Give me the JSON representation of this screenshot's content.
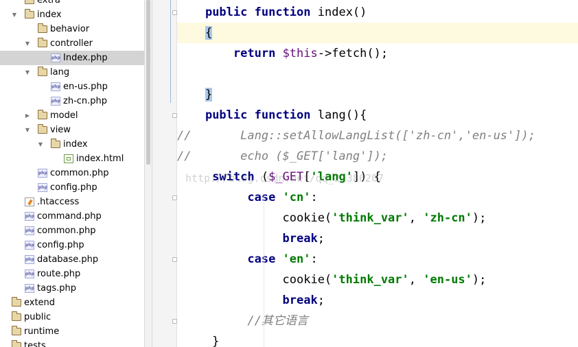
{
  "project_tree": {
    "rows": [
      {
        "label": "extra",
        "type": "folder",
        "depth": 1,
        "arrow": "",
        "selected": false
      },
      {
        "label": "index",
        "type": "folder",
        "depth": 1,
        "arrow": "down",
        "selected": false
      },
      {
        "label": "behavior",
        "type": "folder",
        "depth": 2,
        "arrow": "",
        "selected": false
      },
      {
        "label": "controller",
        "type": "folder",
        "depth": 2,
        "arrow": "down",
        "selected": false
      },
      {
        "label": "Index.php",
        "type": "php",
        "depth": 3,
        "arrow": "",
        "selected": true
      },
      {
        "label": "lang",
        "type": "folder",
        "depth": 2,
        "arrow": "down",
        "selected": false
      },
      {
        "label": "en-us.php",
        "type": "php",
        "depth": 3,
        "arrow": "",
        "selected": false
      },
      {
        "label": "zh-cn.php",
        "type": "php",
        "depth": 3,
        "arrow": "",
        "selected": false
      },
      {
        "label": "model",
        "type": "folder",
        "depth": 2,
        "arrow": "right",
        "selected": false
      },
      {
        "label": "view",
        "type": "folder",
        "depth": 2,
        "arrow": "down",
        "selected": false
      },
      {
        "label": "index",
        "type": "folder",
        "depth": 3,
        "arrow": "down",
        "selected": false
      },
      {
        "label": "index.html",
        "type": "html",
        "depth": 4,
        "arrow": "",
        "selected": false
      },
      {
        "label": "common.php",
        "type": "php",
        "depth": 2,
        "arrow": "",
        "selected": false
      },
      {
        "label": "config.php",
        "type": "php",
        "depth": 2,
        "arrow": "",
        "selected": false
      },
      {
        "label": ".htaccess",
        "type": "hta",
        "depth": 1,
        "arrow": "",
        "selected": false
      },
      {
        "label": "command.php",
        "type": "php",
        "depth": 1,
        "arrow": "",
        "selected": false
      },
      {
        "label": "common.php",
        "type": "php",
        "depth": 1,
        "arrow": "",
        "selected": false
      },
      {
        "label": "config.php",
        "type": "php",
        "depth": 1,
        "arrow": "",
        "selected": false
      },
      {
        "label": "database.php",
        "type": "php",
        "depth": 1,
        "arrow": "",
        "selected": false
      },
      {
        "label": "route.php",
        "type": "php",
        "depth": 1,
        "arrow": "",
        "selected": false
      },
      {
        "label": "tags.php",
        "type": "php",
        "depth": 1,
        "arrow": "",
        "selected": false
      },
      {
        "label": "extend",
        "type": "folder",
        "depth": 0,
        "arrow": "",
        "selected": false
      },
      {
        "label": "public",
        "type": "folder",
        "depth": 0,
        "arrow": "",
        "selected": false
      },
      {
        "label": "runtime",
        "type": "folder",
        "depth": 0,
        "arrow": "",
        "selected": false
      },
      {
        "label": "tests",
        "type": "folder",
        "depth": 0,
        "arrow": "",
        "selected": false
      }
    ]
  },
  "editor": {
    "lines": [
      [
        {
          "t": "    "
        },
        {
          "t": "public",
          "c": "kw"
        },
        {
          "t": " "
        },
        {
          "t": "function",
          "c": "kw"
        },
        {
          "t": " index()"
        }
      ],
      [
        {
          "t": "    "
        },
        {
          "t": "{",
          "c": "brace-hl"
        }
      ],
      [
        {
          "t": "        "
        },
        {
          "t": "return",
          "c": "kw"
        },
        {
          "t": " "
        },
        {
          "t": "$this",
          "c": "var"
        },
        {
          "t": "->fetch();"
        }
      ],
      [
        {
          "t": ""
        }
      ],
      [
        {
          "t": "    "
        },
        {
          "t": "}",
          "c": "brace-hl"
        }
      ],
      [
        {
          "t": "    "
        },
        {
          "t": "public",
          "c": "kw"
        },
        {
          "t": " "
        },
        {
          "t": "function",
          "c": "kw"
        },
        {
          "t": " lang(){"
        }
      ],
      [
        {
          "t": "//       Lang::setAllowLangList(['zh-cn','en-us']);",
          "c": "cm"
        }
      ],
      [
        {
          "t": "//       echo ($_GET['lang']);",
          "c": "cm"
        }
      ],
      [
        {
          "t": "     "
        },
        {
          "t": "switch",
          "c": "kw"
        },
        {
          "t": " ("
        },
        {
          "t": "$_GET",
          "c": "var"
        },
        {
          "t": "["
        },
        {
          "t": "'lang'",
          "c": "str"
        },
        {
          "t": "]) {"
        }
      ],
      [
        {
          "t": "          "
        },
        {
          "t": "case",
          "c": "kw"
        },
        {
          "t": " "
        },
        {
          "t": "'cn'",
          "c": "str"
        },
        {
          "t": ":"
        }
      ],
      [
        {
          "t": "               cookie("
        },
        {
          "t": "'think_var'",
          "c": "str"
        },
        {
          "t": ", "
        },
        {
          "t": "'zh-cn'",
          "c": "str"
        },
        {
          "t": ");"
        }
      ],
      [
        {
          "t": "               "
        },
        {
          "t": "break",
          "c": "kw"
        },
        {
          "t": ";"
        }
      ],
      [
        {
          "t": "          "
        },
        {
          "t": "case",
          "c": "kw"
        },
        {
          "t": " "
        },
        {
          "t": "'en'",
          "c": "str"
        },
        {
          "t": ":"
        }
      ],
      [
        {
          "t": "               cookie("
        },
        {
          "t": "'think_var'",
          "c": "str"
        },
        {
          "t": ", "
        },
        {
          "t": "'en-us'",
          "c": "str"
        },
        {
          "t": ");"
        }
      ],
      [
        {
          "t": "               "
        },
        {
          "t": "break",
          "c": "kw"
        },
        {
          "t": ";"
        }
      ],
      [
        {
          "t": "          "
        },
        {
          "t": "//其它语言",
          "c": "cm"
        }
      ],
      [
        {
          "t": "     }"
        }
      ]
    ],
    "current_line": 1,
    "watermark": "http://blog.csdn.net/qq_21386207"
  },
  "icons": {
    "folder": "folder-icon",
    "php": "php-file-icon",
    "html": "html-file-icon",
    "hta": "htaccess-file-icon",
    "expand": "chevron-down-icon",
    "collapse": "chevron-right-icon"
  },
  "colors": {
    "keyword": "#000080",
    "string": "#007a00",
    "variable": "#660e7a",
    "comment": "#808080",
    "selection": "#d4d4d4",
    "current_line": "#fdfae0",
    "brace_match": "#a8c8ea"
  }
}
